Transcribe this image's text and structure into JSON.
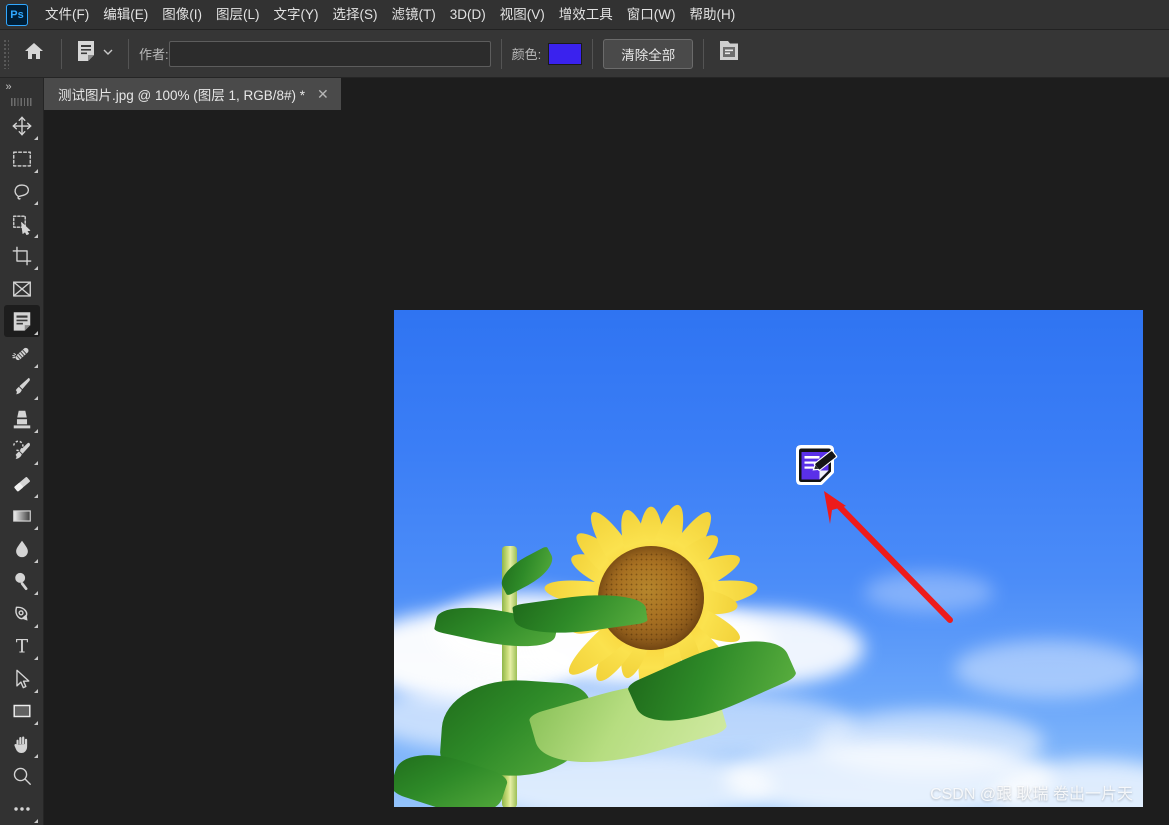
{
  "app": {
    "logo_text": "Ps",
    "logo_name": "photoshop-logo"
  },
  "menubar": {
    "items": [
      {
        "label": "文件(F)",
        "name": "menu-file"
      },
      {
        "label": "编辑(E)",
        "name": "menu-edit"
      },
      {
        "label": "图像(I)",
        "name": "menu-image"
      },
      {
        "label": "图层(L)",
        "name": "menu-layer"
      },
      {
        "label": "文字(Y)",
        "name": "menu-type"
      },
      {
        "label": "选择(S)",
        "name": "menu-select"
      },
      {
        "label": "滤镜(T)",
        "name": "menu-filter"
      },
      {
        "label": "3D(D)",
        "name": "menu-3d"
      },
      {
        "label": "视图(V)",
        "name": "menu-view"
      },
      {
        "label": "增效工具",
        "name": "menu-plugins"
      },
      {
        "label": "窗口(W)",
        "name": "menu-window"
      },
      {
        "label": "帮助(H)",
        "name": "menu-help"
      }
    ]
  },
  "optionsbar": {
    "home_icon": "home-icon",
    "tool_preset_icon": "note-tool-icon",
    "tool_preset_chevron": "chevron-down-icon",
    "author_label": "作者:",
    "author_value": "",
    "author_placeholder": "",
    "color_label": "颜色:",
    "color_value": "#3A22EE",
    "clear_all_label": "清除全部",
    "notes_panel_icon": "notes-panel-icon"
  },
  "toolbar": {
    "collapse_label": "»",
    "tools": [
      {
        "name": "tool-move",
        "label": "移动工具",
        "icon": "move-icon",
        "active": false,
        "has_flyout": true
      },
      {
        "name": "tool-rectangular-marquee",
        "label": "矩形选框工具",
        "icon": "marquee-icon",
        "active": false,
        "has_flyout": true
      },
      {
        "name": "tool-lasso",
        "label": "套索工具",
        "icon": "lasso-icon",
        "active": false,
        "has_flyout": true
      },
      {
        "name": "tool-quick-selection",
        "label": "快速选择工具",
        "icon": "quick-selection-icon",
        "active": false,
        "has_flyout": true
      },
      {
        "name": "tool-crop",
        "label": "裁剪工具",
        "icon": "crop-icon",
        "active": false,
        "has_flyout": true
      },
      {
        "name": "tool-frame",
        "label": "画框工具",
        "icon": "frame-icon",
        "active": false,
        "has_flyout": false
      },
      {
        "name": "tool-note",
        "label": "注释工具",
        "icon": "note-icon",
        "active": true,
        "has_flyout": true
      },
      {
        "name": "tool-healing-brush",
        "label": "污点修复画笔",
        "icon": "healing-brush-icon",
        "active": false,
        "has_flyout": true
      },
      {
        "name": "tool-brush",
        "label": "画笔工具",
        "icon": "brush-icon",
        "active": false,
        "has_flyout": true
      },
      {
        "name": "tool-clone-stamp",
        "label": "仿制图章工具",
        "icon": "clone-stamp-icon",
        "active": false,
        "has_flyout": true
      },
      {
        "name": "tool-history-brush",
        "label": "历史记录画笔",
        "icon": "history-brush-icon",
        "active": false,
        "has_flyout": true
      },
      {
        "name": "tool-eraser",
        "label": "橡皮擦工具",
        "icon": "eraser-icon",
        "active": false,
        "has_flyout": true
      },
      {
        "name": "tool-gradient",
        "label": "渐变工具",
        "icon": "gradient-icon",
        "active": false,
        "has_flyout": true
      },
      {
        "name": "tool-blur",
        "label": "模糊工具",
        "icon": "blur-drop-icon",
        "active": false,
        "has_flyout": true
      },
      {
        "name": "tool-dodge",
        "label": "减淡工具",
        "icon": "dodge-icon",
        "active": false,
        "has_flyout": true
      },
      {
        "name": "tool-pen",
        "label": "钢笔工具",
        "icon": "pen-icon",
        "active": false,
        "has_flyout": true
      },
      {
        "name": "tool-type",
        "label": "横排文字工具",
        "icon": "type-t-icon",
        "active": false,
        "has_flyout": true
      },
      {
        "name": "tool-path-selection",
        "label": "路径选择工具",
        "icon": "path-selection-icon",
        "active": false,
        "has_flyout": true
      },
      {
        "name": "tool-shape",
        "label": "矩形工具",
        "icon": "shape-rect-icon",
        "active": false,
        "has_flyout": true
      },
      {
        "name": "tool-hand",
        "label": "抓手工具",
        "icon": "hand-icon",
        "active": false,
        "has_flyout": true
      },
      {
        "name": "tool-zoom",
        "label": "缩放工具",
        "icon": "zoom-magnifier-icon",
        "active": false,
        "has_flyout": false
      },
      {
        "name": "tool-more",
        "label": "编辑工具栏",
        "icon": "ellipsis-icon",
        "active": false,
        "has_flyout": true
      }
    ]
  },
  "tabbar": {
    "document_title": "测试图片.jpg @ 100% (图层 1, RGB/8#) *",
    "close_glyph": "✕"
  },
  "canvas": {
    "watermark": "CSDN @跟 耿瑞 卷出一片天",
    "note_marker_name": "note-annotation-marker",
    "arrow_name": "red-annotation-arrow",
    "image_subject": "sunflower-photo"
  }
}
